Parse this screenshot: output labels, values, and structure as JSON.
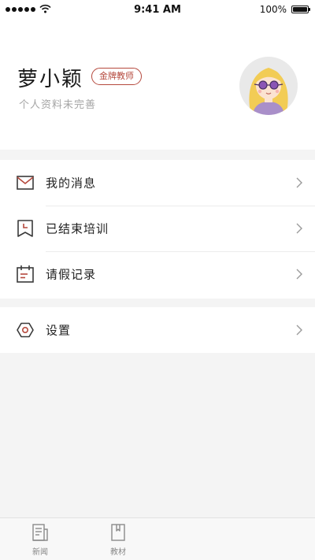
{
  "status_bar": {
    "time": "9:41 AM",
    "battery": "100%"
  },
  "profile": {
    "name": "萝小颖",
    "badge": "金牌教师",
    "subtitle": "个人资料未完善",
    "avatar": "avatar-girl-with-sunglasses"
  },
  "menu": {
    "items": [
      {
        "label": "我的消息",
        "icon": "mail-icon"
      },
      {
        "label": "已结束培训",
        "icon": "clock-bookmark-icon"
      },
      {
        "label": "请假记录",
        "icon": "calendar-icon"
      }
    ],
    "settings": {
      "label": "设置",
      "icon": "gear-hexagon-icon"
    }
  },
  "tab_bar": {
    "tabs": [
      {
        "label": "新闻",
        "icon": "news-icon"
      },
      {
        "label": "教材",
        "icon": "book-icon"
      }
    ]
  },
  "colors": {
    "accent": "#b5493d",
    "icon": "#3a3a3a",
    "background": "#f4f4f4"
  }
}
